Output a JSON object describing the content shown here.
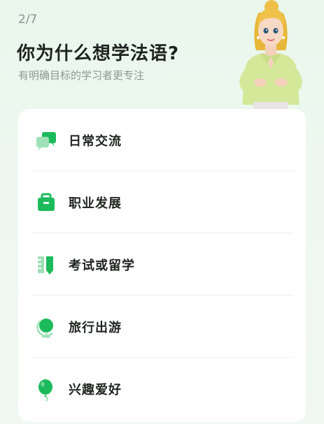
{
  "header": {
    "step": "2/7",
    "title": "你为什么想学法语?",
    "subtitle": "有明确目标的学习者更专注"
  },
  "options": [
    {
      "label": "日常交流",
      "icon": "chat-bubbles-icon"
    },
    {
      "label": "职业发展",
      "icon": "briefcase-icon"
    },
    {
      "label": "考试或留学",
      "icon": "ruler-pencil-icon"
    },
    {
      "label": "旅行出游",
      "icon": "globe-icon"
    },
    {
      "label": "兴趣爱好",
      "icon": "balloon-icon"
    }
  ],
  "colors": {
    "accent": "#1dba5c",
    "accent_light": "#8fdcaa",
    "background": "#ebf7ee",
    "card": "#ffffff"
  }
}
